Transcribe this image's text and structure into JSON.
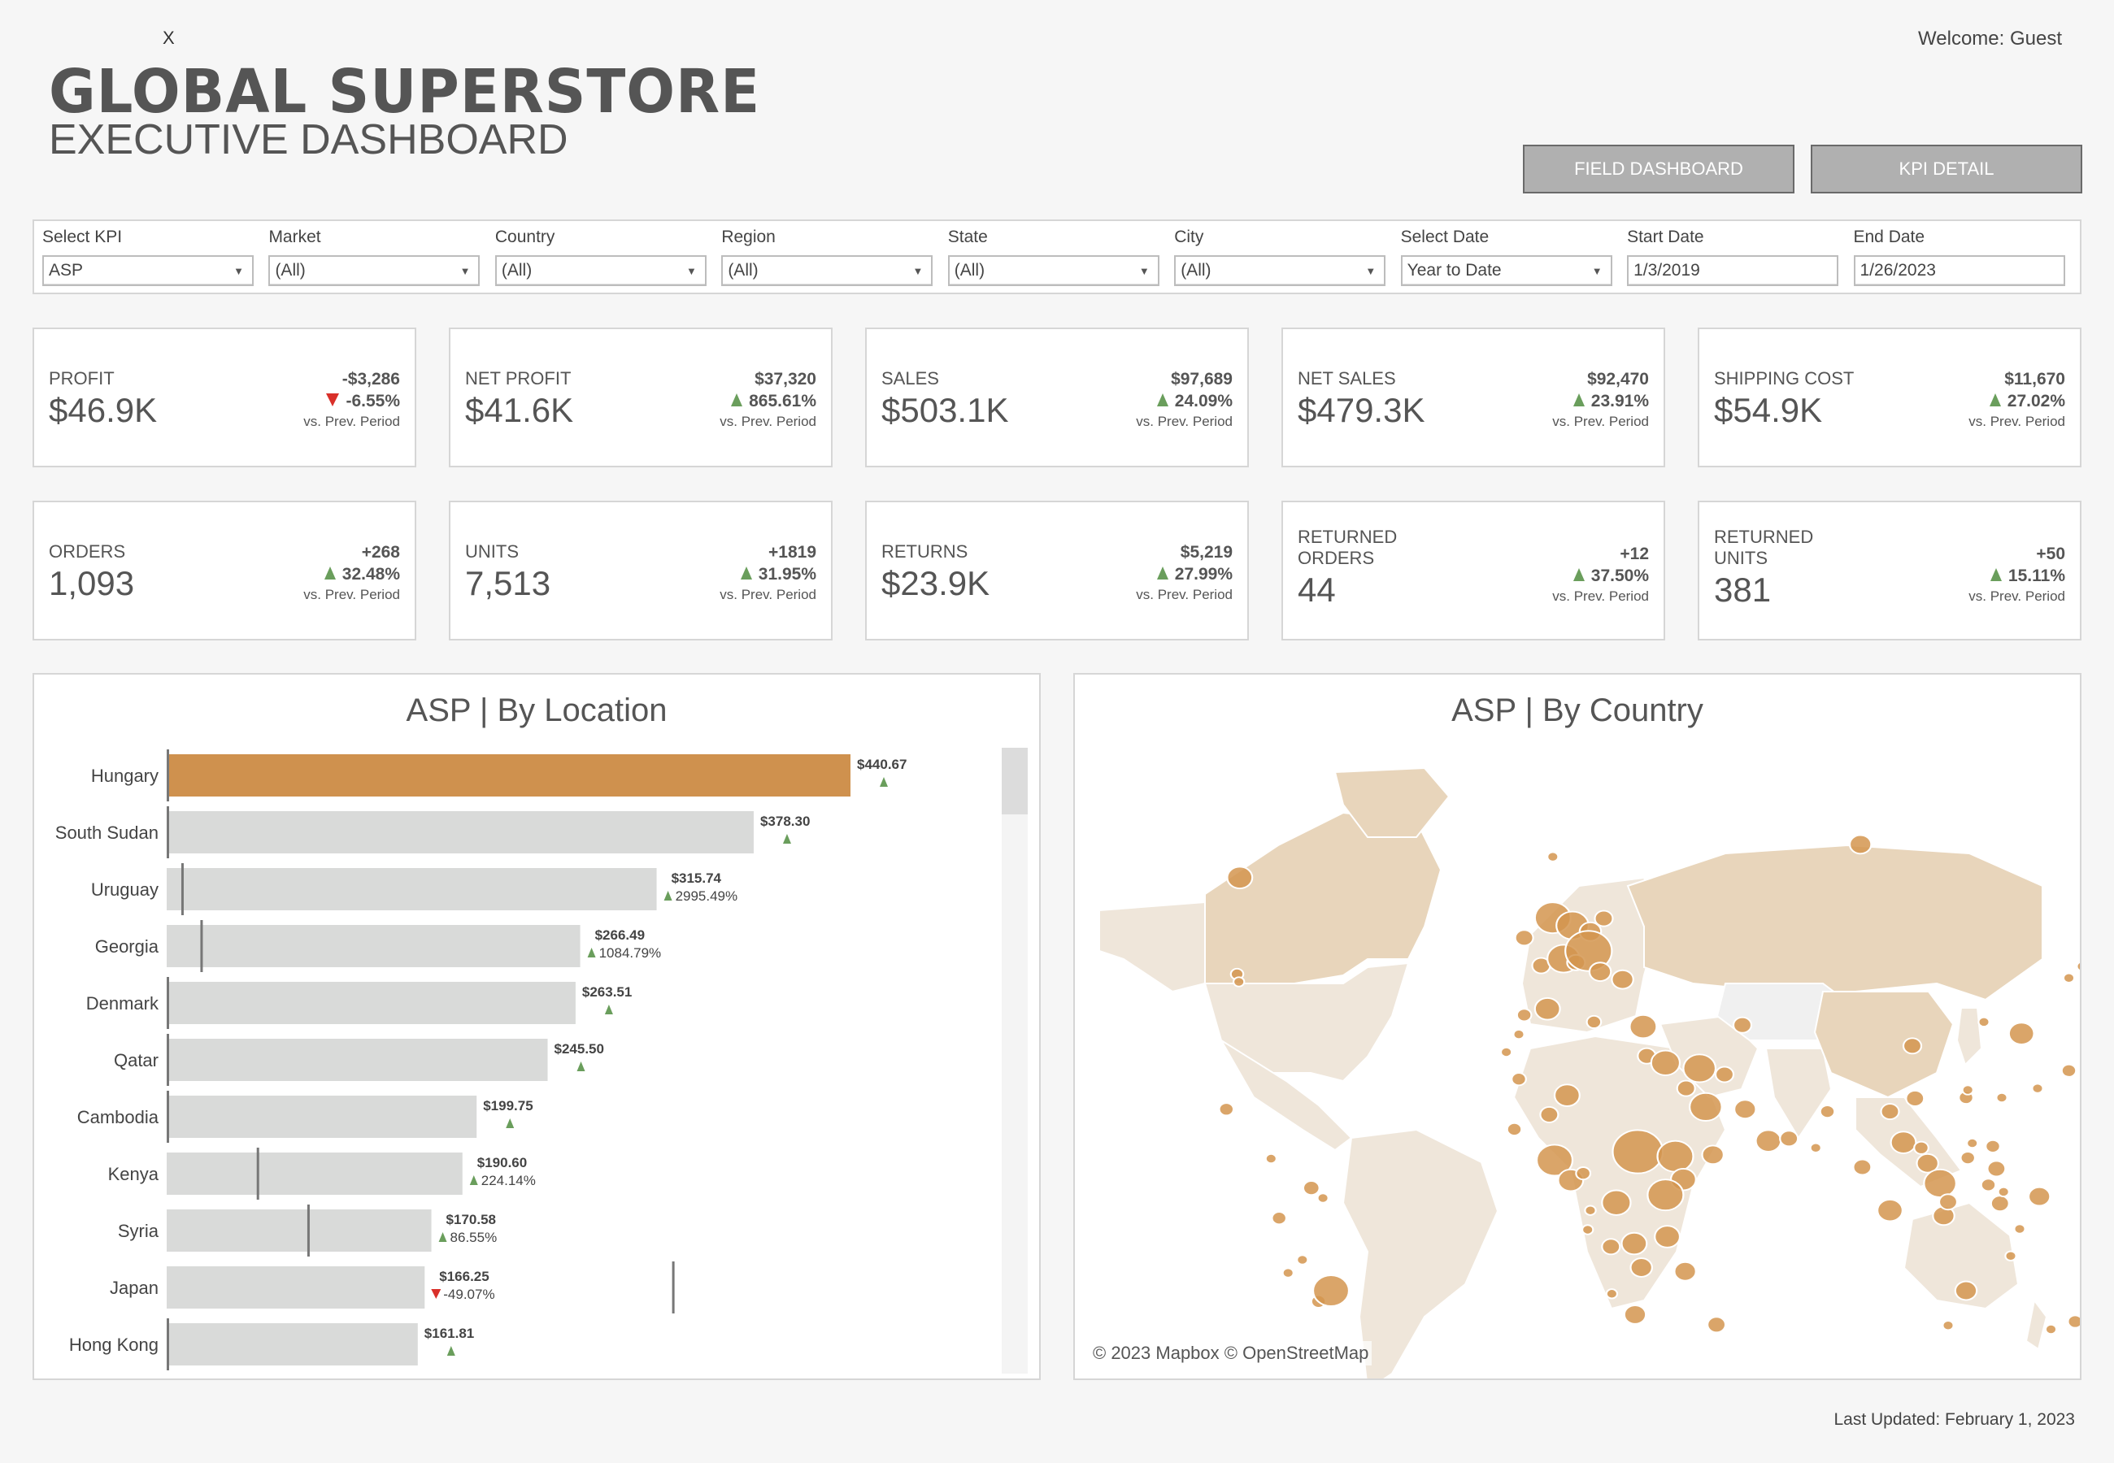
{
  "header": {
    "close_label": "X",
    "title": "GLOBAL SUPERSTORE",
    "subtitle": "EXECUTIVE DASHBOARD",
    "welcome": "Welcome: Guest",
    "buttons": {
      "field_dashboard": "FIELD DASHBOARD",
      "kpi_detail": "KPI DETAIL"
    }
  },
  "filters": [
    {
      "label": "Select KPI",
      "value": "ASP",
      "type": "dropdown"
    },
    {
      "label": "Market",
      "value": "(All)",
      "type": "dropdown"
    },
    {
      "label": "Country",
      "value": "(All)",
      "type": "dropdown"
    },
    {
      "label": "Region",
      "value": "(All)",
      "type": "dropdown"
    },
    {
      "label": "State",
      "value": "(All)",
      "type": "dropdown"
    },
    {
      "label": "City",
      "value": "(All)",
      "type": "dropdown"
    },
    {
      "label": "Select Date",
      "value": "Year to Date",
      "type": "dropdown"
    },
    {
      "label": "Start Date",
      "value": "1/3/2019",
      "type": "input"
    },
    {
      "label": "End Date",
      "value": "1/26/2023",
      "type": "input"
    }
  ],
  "kpis": [
    {
      "label": "PROFIT",
      "value": "$46.9K",
      "delta": "-$3,286",
      "pct": "-6.55%",
      "direction": "down",
      "vs": "vs. Prev. Period"
    },
    {
      "label": "NET PROFIT",
      "value": "$41.6K",
      "delta": "$37,320",
      "pct": "865.61%",
      "direction": "up",
      "vs": "vs. Prev. Period"
    },
    {
      "label": "SALES",
      "value": "$503.1K",
      "delta": "$97,689",
      "pct": "24.09%",
      "direction": "up",
      "vs": "vs. Prev. Period"
    },
    {
      "label": "NET SALES",
      "value": "$479.3K",
      "delta": "$92,470",
      "pct": "23.91%",
      "direction": "up",
      "vs": "vs. Prev. Period"
    },
    {
      "label": "SHIPPING COST",
      "value": "$54.9K",
      "delta": "$11,670",
      "pct": "27.02%",
      "direction": "up",
      "vs": "vs. Prev. Period"
    },
    {
      "label": "ORDERS",
      "value": "1,093",
      "delta": "+268",
      "pct": "32.48%",
      "direction": "up",
      "vs": "vs. Prev. Period"
    },
    {
      "label": "UNITS",
      "value": "7,513",
      "delta": "+1819",
      "pct": "31.95%",
      "direction": "up",
      "vs": "vs. Prev. Period"
    },
    {
      "label": "RETURNS",
      "value": "$23.9K",
      "delta": "$5,219",
      "pct": "27.99%",
      "direction": "up",
      "vs": "vs. Prev. Period"
    },
    {
      "label": "RETURNED ORDERS",
      "label_lines": [
        "RETURNED",
        "ORDERS"
      ],
      "value": "44",
      "delta": "+12",
      "pct": "37.50%",
      "direction": "up",
      "vs": "vs. Prev. Period"
    },
    {
      "label": "RETURNED UNITS",
      "label_lines": [
        "RETURNED",
        "UNITS"
      ],
      "value": "381",
      "delta": "+50",
      "pct": "15.11%",
      "direction": "up",
      "vs": "vs. Prev. Period"
    }
  ],
  "colors": {
    "highlight_bar": "#cf914e",
    "bar": "#d9dad9",
    "reference_line": "#777777",
    "up": "#6a9e5c",
    "down": "#d9302a",
    "map_land_high": "#e8d5bb",
    "map_land_low": "#efe6da",
    "map_land_none": "#f0f0f0",
    "map_bubble": "#d4954f"
  },
  "chart_data": [
    {
      "type": "bar",
      "orientation": "horizontal",
      "title": "ASP | By Location",
      "categories": [
        "Hungary",
        "South Sudan",
        "Uruguay",
        "Georgia",
        "Denmark",
        "Qatar",
        "Cambodia",
        "Kenya",
        "Syria",
        "Japan",
        "Hong Kong"
      ],
      "values": [
        440.67,
        378.3,
        315.74,
        266.49,
        263.51,
        245.5,
        199.75,
        190.6,
        170.58,
        166.25,
        161.81
      ],
      "value_labels": [
        "$440.67",
        "$378.30",
        "$315.74",
        "$266.49",
        "$263.51",
        "$245.50",
        "$199.75",
        "$190.60",
        "$170.58",
        "$166.25",
        "$161.81"
      ],
      "change_pct_labels": [
        "",
        "",
        "2995.49%",
        "1084.79%",
        "",
        "",
        "",
        "224.14%",
        "86.55%",
        "-49.07%",
        ""
      ],
      "change_direction": [
        "up",
        "up",
        "up",
        "up",
        "up",
        "up",
        "up",
        "up",
        "up",
        "down",
        "up"
      ],
      "prev_period_values": [
        0,
        0,
        10.2,
        22.5,
        0,
        0,
        0,
        58.8,
        91.4,
        326.5,
        0
      ],
      "highlighted": "Hungary",
      "xlim": [
        0,
        580
      ],
      "xlabel": "",
      "ylabel": "",
      "grid": false
    },
    {
      "type": "scatter",
      "subtype": "bubble-map",
      "title": "ASP | By Country",
      "attribution": "© 2023 Mapbox  © OpenStreetMap"
    }
  ],
  "footer": {
    "last_updated": "Last Updated: February 1, 2023"
  }
}
